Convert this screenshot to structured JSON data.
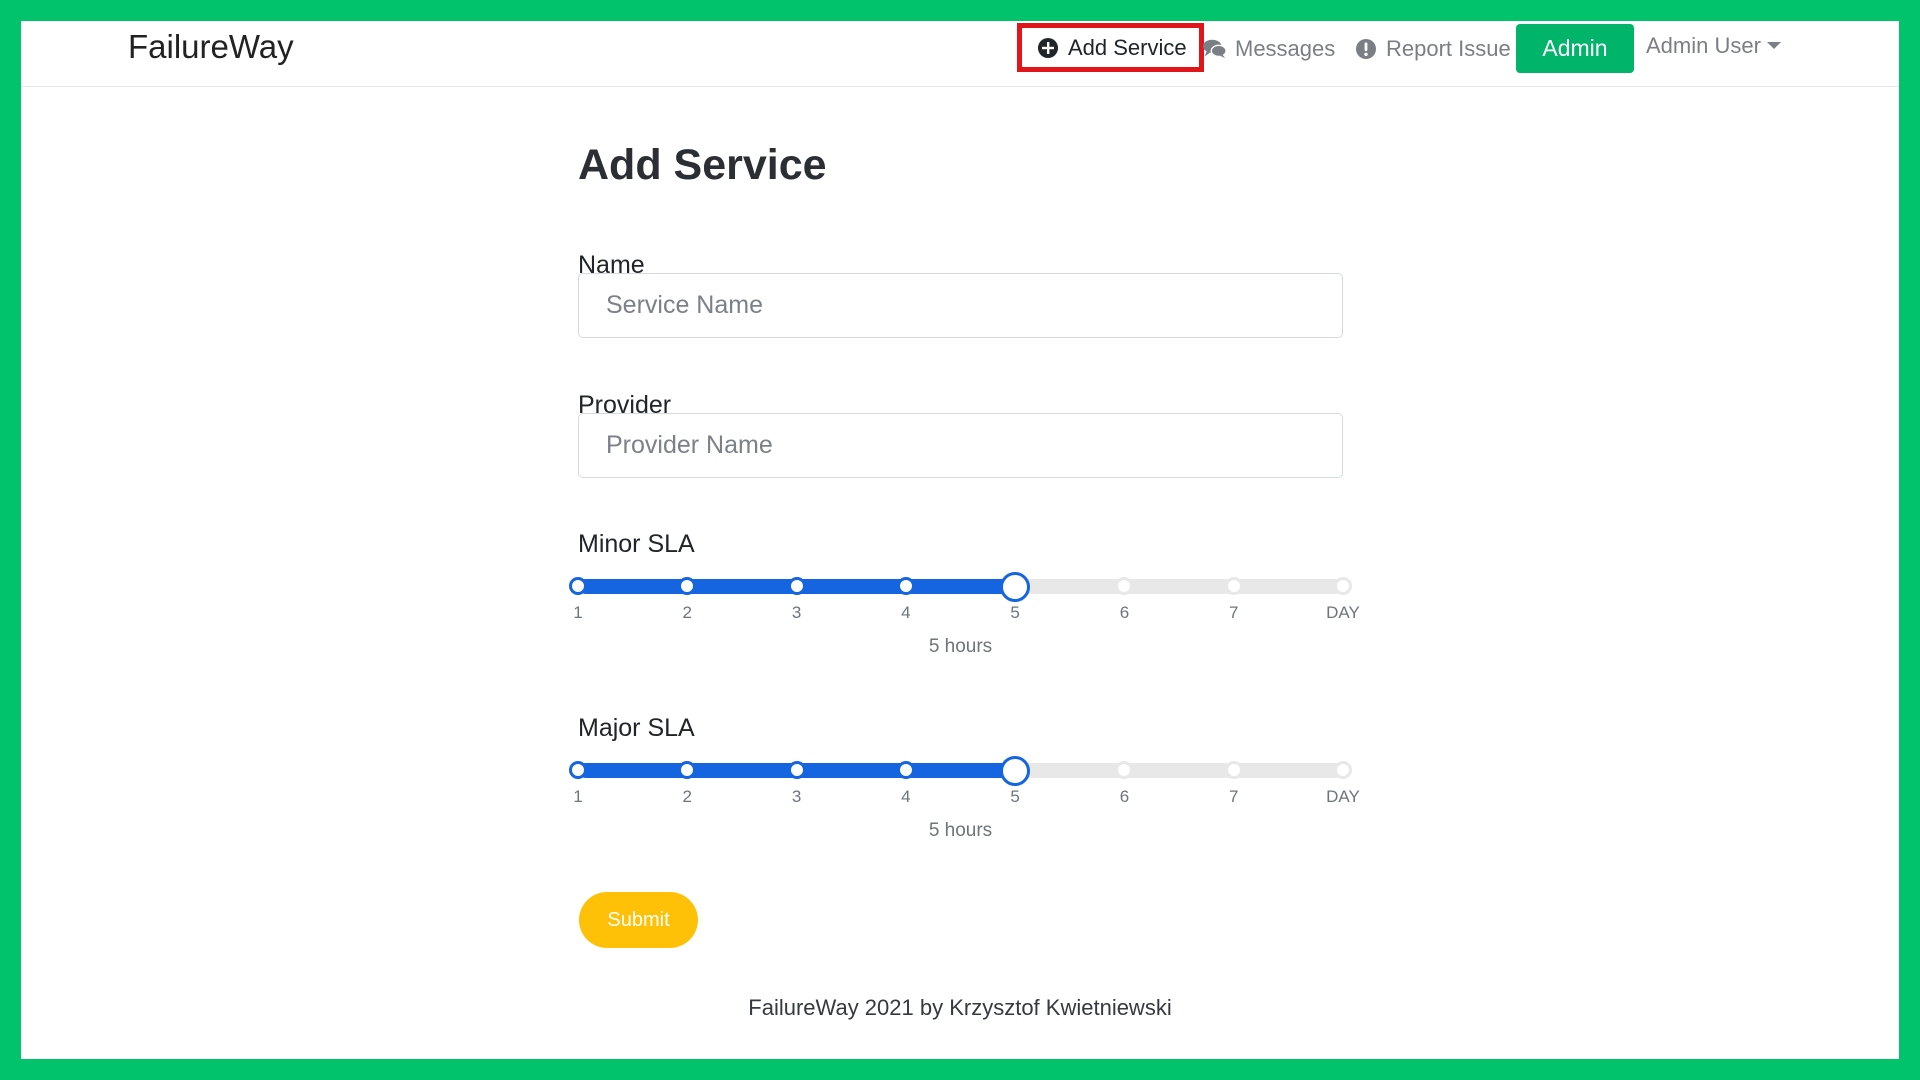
{
  "app": {
    "brand": "FailureWay"
  },
  "nav": {
    "add_service": "Add Service",
    "messages": "Messages",
    "report_issue": "Report Issue",
    "admin": "Admin",
    "user": "Admin User"
  },
  "form": {
    "title": "Add Service",
    "name_label": "Name",
    "name_placeholder": "Service Name",
    "provider_label": "Provider",
    "provider_placeholder": "Provider Name",
    "minor_sla": {
      "label": "Minor SLA",
      "ticks": [
        "1",
        "2",
        "3",
        "4",
        "5",
        "6",
        "7",
        "DAY"
      ],
      "selected_index": 4,
      "value_text": "5 hours"
    },
    "major_sla": {
      "label": "Major SLA",
      "ticks": [
        "1",
        "2",
        "3",
        "4",
        "5",
        "6",
        "7",
        "DAY"
      ],
      "selected_index": 4,
      "value_text": "5 hours"
    },
    "submit": "Submit"
  },
  "footer": {
    "text": "FailureWay 2021 by Krzysztof Kwietniewski"
  },
  "colors": {
    "accent_green": "#00b469",
    "slider_blue": "#1565e0",
    "submit_yellow": "#ffc107",
    "highlight_red": "#e0161b"
  },
  "icons": {
    "add_service": "plus-circle-icon",
    "messages": "comments-icon",
    "report_issue": "exclamation-circle-icon"
  }
}
